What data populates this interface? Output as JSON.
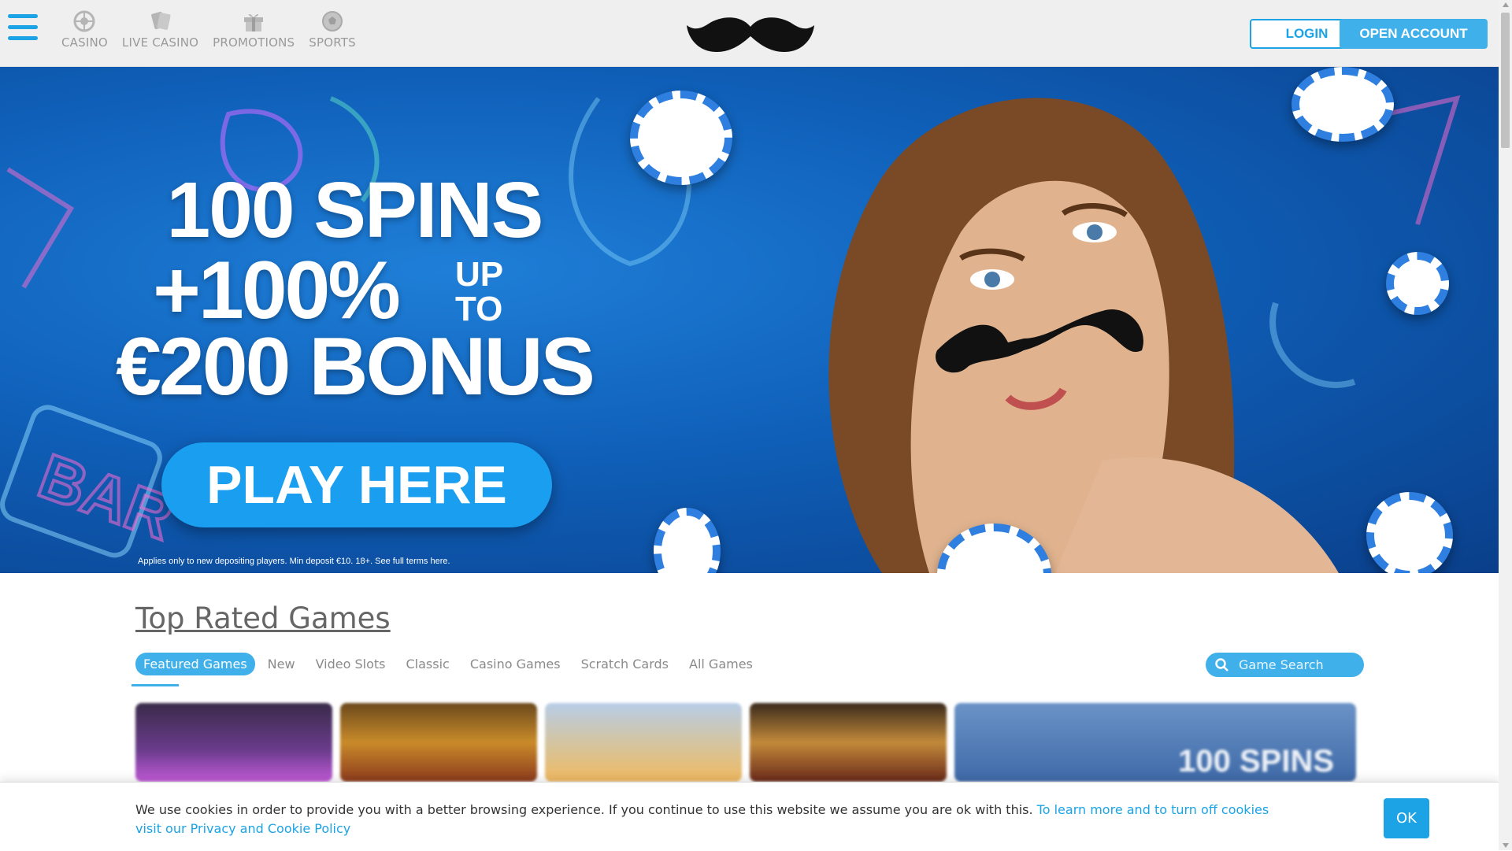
{
  "header": {
    "nav": [
      {
        "label": "CASINO",
        "icon": "roulette-icon"
      },
      {
        "label": "LIVE CASINO",
        "icon": "cards-icon"
      },
      {
        "label": "PROMOTIONS",
        "icon": "gift-icon"
      },
      {
        "label": "SPORTS",
        "icon": "football-icon"
      }
    ],
    "login_label": "LOGIN",
    "open_account_label": "OPEN ACCOUNT",
    "accent_color": "#1ba3e6"
  },
  "hero": {
    "line1": "100 SPINS",
    "line2": "+100%",
    "upto_line1": "UP",
    "upto_line2": "TO",
    "line3": "€200 BONUS",
    "cta_label": "PLAY HERE",
    "terms": "Applies only to new depositing players. Min deposit €10. 18+. See full terms here."
  },
  "games": {
    "title": "Top Rated Games",
    "tabs": [
      {
        "label": "Featured Games",
        "active": true
      },
      {
        "label": "New",
        "active": false
      },
      {
        "label": "Video Slots",
        "active": false
      },
      {
        "label": "Classic",
        "active": false
      },
      {
        "label": "Casino Games",
        "active": false
      },
      {
        "label": "Scratch Cards",
        "active": false
      },
      {
        "label": "All Games",
        "active": false
      }
    ],
    "search_placeholder": "Game Search",
    "promo_tile_text": "100 SPINS"
  },
  "cookie": {
    "text": "We use cookies in order to provide you with a better browsing experience. If you continue to use this website we assume you are ok with this.",
    "link_text": "To learn more and to turn off cookies visit our Privacy and Cookie Policy",
    "ok_label": "OK"
  }
}
